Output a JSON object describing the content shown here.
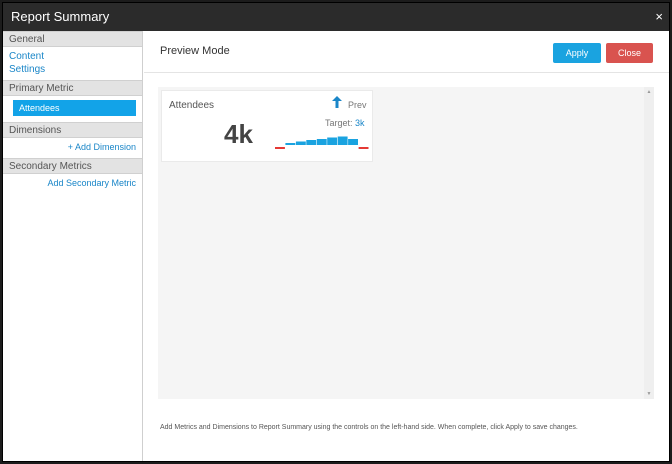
{
  "dialog": {
    "title": "Report Summary",
    "close_glyph": "×"
  },
  "sidebar": {
    "general": {
      "title": "General",
      "links": [
        "Content",
        "Settings"
      ]
    },
    "primary": {
      "title": "Primary Metric",
      "selected": "Attendees"
    },
    "third": {
      "title": "Dimensions",
      "link": "+ Add Dimension"
    },
    "secondary": {
      "title": "Secondary Metrics",
      "link": "Add Secondary Metric"
    }
  },
  "main": {
    "title": "Preview Mode",
    "apply_label": "Apply",
    "close_label": "Close"
  },
  "card": {
    "label": "Attendees",
    "value": "4k",
    "trend_word": "Prev",
    "period_label": "Target:",
    "period_value": "3k"
  },
  "footnote": "Add Metrics and Dimensions to Report Summary using the controls on the left-hand side. When complete, click Apply to save changes.",
  "colors": {
    "accent": "#12a3e8",
    "danger": "#d9534f",
    "titlebar": "#2b2b2b"
  },
  "icons": {
    "close": "close-icon",
    "trend": "arrow-up-icon"
  },
  "chart_data": {
    "type": "bar",
    "values": [
      -0.6,
      0.2,
      0.35,
      0.5,
      0.6,
      0.75,
      0.85,
      0.6,
      -0.6
    ],
    "colors": [
      "#e53935",
      "#1aa3e0",
      "#1aa3e0",
      "#1aa3e0",
      "#1aa3e0",
      "#1aa3e0",
      "#1aa3e0",
      "#1aa3e0",
      "#e53935"
    ]
  }
}
